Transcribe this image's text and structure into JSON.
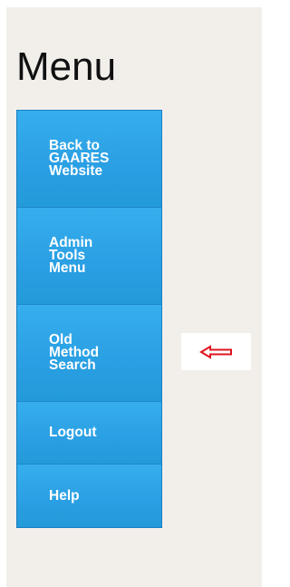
{
  "title": "Menu",
  "menu": {
    "items": [
      {
        "label": "Back to\nGAARES\nWebsite"
      },
      {
        "label": "Admin\nTools\nMenu"
      },
      {
        "label": "Old\nMethod\nSearch"
      },
      {
        "label": "Logout"
      },
      {
        "label": "Help"
      }
    ]
  },
  "annotation": {
    "icon": "left-arrow-icon",
    "color": "#e0141e"
  },
  "colors": {
    "background": "#f2efeb",
    "button": "#2aa3e6",
    "button_text": "#ffffff"
  }
}
